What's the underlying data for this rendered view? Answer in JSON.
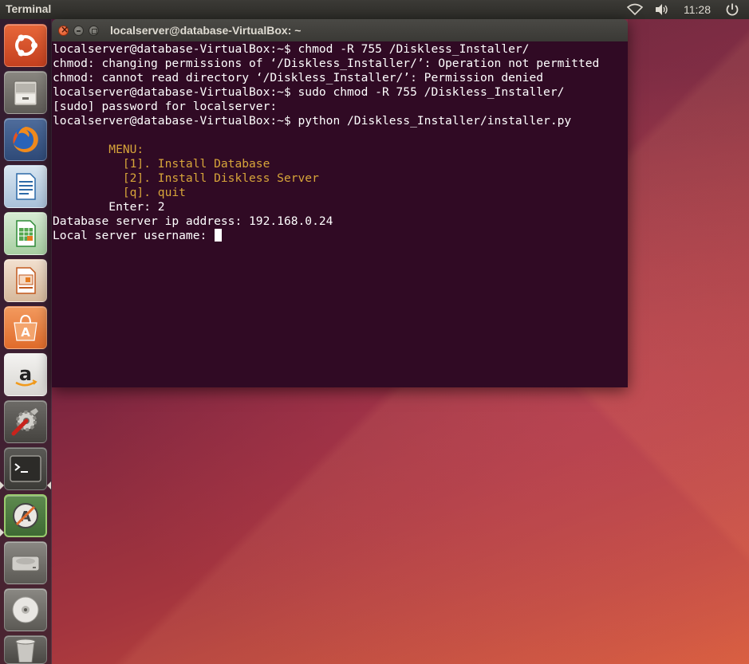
{
  "panel": {
    "app_title": "Terminal",
    "clock": "11:28",
    "icons": [
      "wifi-icon",
      "volume-icon",
      "power-icon"
    ]
  },
  "launcher": {
    "items": [
      {
        "name": "dash-home-icon"
      },
      {
        "name": "files-icon"
      },
      {
        "name": "firefox-icon"
      },
      {
        "name": "libreoffice-writer-icon"
      },
      {
        "name": "libreoffice-calc-icon"
      },
      {
        "name": "libreoffice-impress-icon"
      },
      {
        "name": "software-center-icon"
      },
      {
        "name": "amazon-icon"
      },
      {
        "name": "system-settings-icon"
      },
      {
        "name": "terminal-icon"
      },
      {
        "name": "software-updater-icon"
      },
      {
        "name": "disk-drive-icon"
      },
      {
        "name": "dvd-icon"
      },
      {
        "name": "trash-icon"
      }
    ]
  },
  "terminal": {
    "window_title": "localserver@database-VirtualBox: ~",
    "lines": [
      {
        "text": "localserver@database-VirtualBox:~$ chmod -R 755 /Diskless_Installer/",
        "style": "normal"
      },
      {
        "text": "chmod: changing permissions of ‘/Diskless_Installer/’: Operation not permitted",
        "style": "normal"
      },
      {
        "text": "chmod: cannot read directory ‘/Diskless_Installer/’: Permission denied",
        "style": "normal"
      },
      {
        "text": "localserver@database-VirtualBox:~$ sudo chmod -R 755 /Diskless_Installer/",
        "style": "normal"
      },
      {
        "text": "[sudo] password for localserver:",
        "style": "normal"
      },
      {
        "text": "localserver@database-VirtualBox:~$ python /Diskless_Installer/installer.py",
        "style": "normal"
      },
      {
        "text": "",
        "style": "normal"
      },
      {
        "text": "        MENU:",
        "style": "menu"
      },
      {
        "text": "          [1]. Install Database",
        "style": "menu"
      },
      {
        "text": "          [2]. Install Diskless Server",
        "style": "menu"
      },
      {
        "text": "          [q]. quit",
        "style": "menu"
      },
      {
        "text": "        Enter: 2",
        "style": "normal"
      },
      {
        "text": "Database server ip address: 192.168.0.24",
        "style": "normal"
      },
      {
        "text": "Local server username: ",
        "style": "normal"
      }
    ]
  },
  "colors": {
    "terminal_bg": "#300a24",
    "menu_text": "#d7a53a",
    "text": "#ffffff"
  }
}
